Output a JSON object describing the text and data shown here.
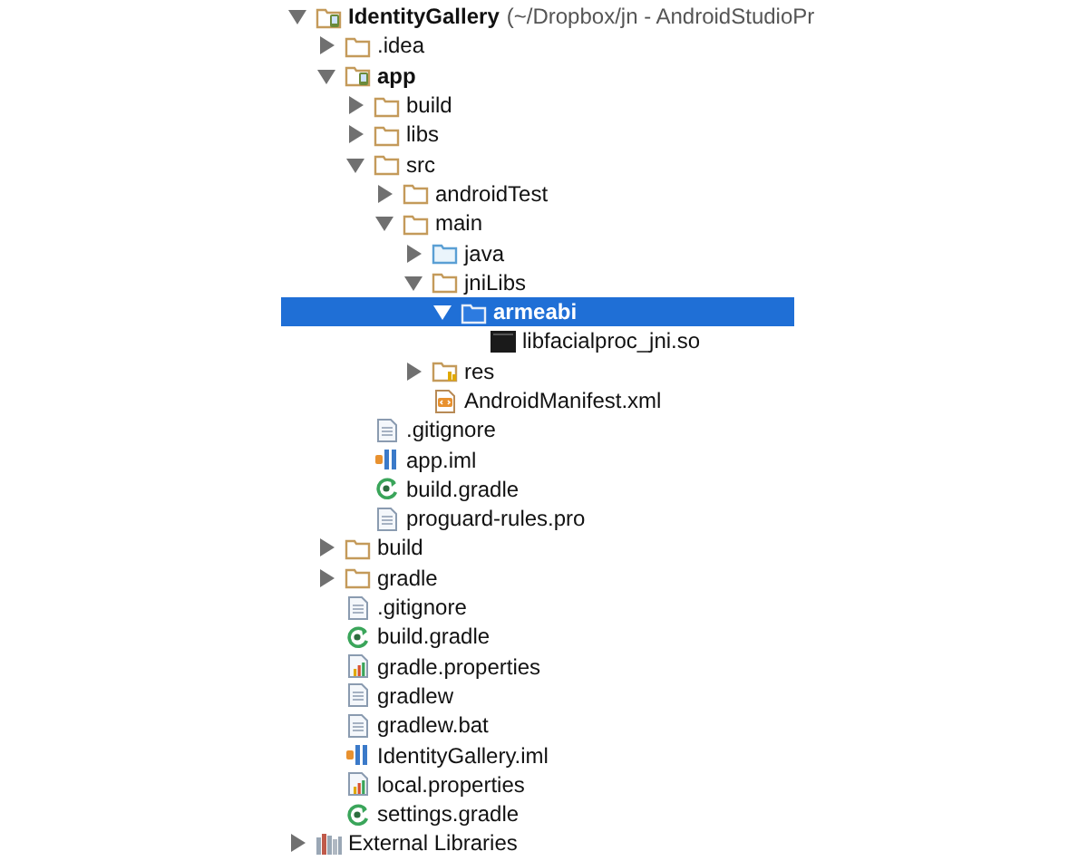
{
  "project_tree": [
    {
      "label": "IdentityGallery",
      "path": "(~/Dropbox/jn - AndroidStudioPr",
      "kind": "module",
      "expanded": true,
      "selected": false,
      "children": [
        {
          "label": ".idea",
          "kind": "folder",
          "expanded": false,
          "selected": false
        },
        {
          "label": "app",
          "kind": "module",
          "expanded": true,
          "selected": false,
          "children": [
            {
              "label": "build",
              "kind": "folder",
              "expanded": false,
              "selected": false
            },
            {
              "label": "libs",
              "kind": "folder",
              "expanded": false,
              "selected": false
            },
            {
              "label": "src",
              "kind": "folder",
              "expanded": true,
              "selected": false,
              "children": [
                {
                  "label": "androidTest",
                  "kind": "folder",
                  "expanded": false,
                  "selected": false
                },
                {
                  "label": "main",
                  "kind": "folder",
                  "expanded": true,
                  "selected": false,
                  "children": [
                    {
                      "label": "java",
                      "kind": "source-folder",
                      "expanded": false,
                      "selected": false
                    },
                    {
                      "label": "jniLibs",
                      "kind": "folder",
                      "expanded": true,
                      "selected": false,
                      "children": [
                        {
                          "label": "armeabi",
                          "kind": "folder",
                          "expanded": true,
                          "selected": true,
                          "children": [
                            {
                              "label": "libfacialproc_jni.so",
                              "kind": "binary",
                              "selected": false
                            }
                          ]
                        }
                      ]
                    },
                    {
                      "label": "res",
                      "kind": "res-folder",
                      "expanded": false,
                      "selected": false
                    },
                    {
                      "label": "AndroidManifest.xml",
                      "kind": "xml",
                      "selected": false
                    }
                  ]
                }
              ]
            },
            {
              "label": ".gitignore",
              "kind": "text",
              "selected": false
            },
            {
              "label": "app.iml",
              "kind": "iml",
              "selected": false
            },
            {
              "label": "build.gradle",
              "kind": "gradle",
              "selected": false
            },
            {
              "label": "proguard-rules.pro",
              "kind": "text",
              "selected": false
            }
          ]
        },
        {
          "label": "build",
          "kind": "folder",
          "expanded": false,
          "selected": false
        },
        {
          "label": "gradle",
          "kind": "folder",
          "expanded": false,
          "selected": false
        },
        {
          "label": ".gitignore",
          "kind": "text",
          "selected": false
        },
        {
          "label": "build.gradle",
          "kind": "gradle",
          "selected": false
        },
        {
          "label": "gradle.properties",
          "kind": "properties",
          "selected": false
        },
        {
          "label": "gradlew",
          "kind": "text",
          "selected": false
        },
        {
          "label": "gradlew.bat",
          "kind": "text",
          "selected": false
        },
        {
          "label": "IdentityGallery.iml",
          "kind": "iml",
          "selected": false
        },
        {
          "label": "local.properties",
          "kind": "properties",
          "selected": false
        },
        {
          "label": "settings.gradle",
          "kind": "gradle",
          "selected": false
        }
      ]
    },
    {
      "label": "External Libraries",
      "kind": "libraries",
      "expanded": false,
      "selected": false
    }
  ]
}
